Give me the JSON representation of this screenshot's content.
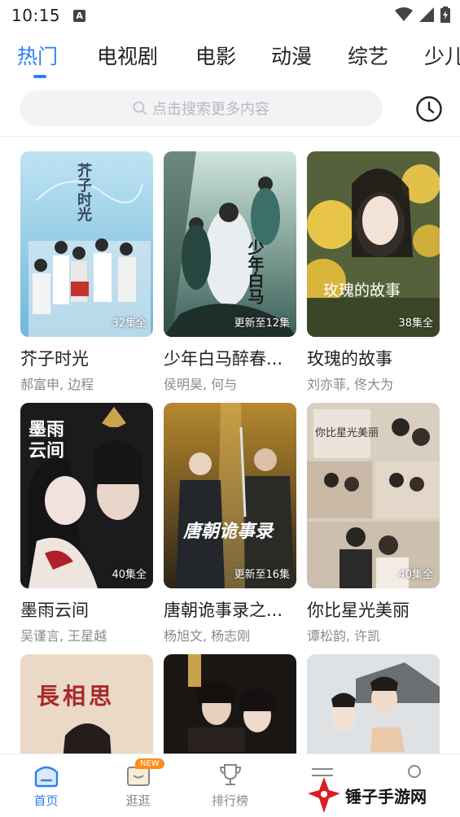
{
  "status_bar": {
    "time": "10:15",
    "notif_letter": "A"
  },
  "tabs": [
    {
      "label": "热门",
      "active": true
    },
    {
      "label": "电视剧",
      "active": false
    },
    {
      "label": "电影",
      "active": false
    },
    {
      "label": "动漫",
      "active": false
    },
    {
      "label": "综艺",
      "active": false
    },
    {
      "label": "少儿",
      "active": false
    }
  ],
  "search": {
    "placeholder": "点击搜索更多内容",
    "icon": "search-icon"
  },
  "history_icon": "clock-icon",
  "cards": [
    {
      "title": "芥子时光",
      "cast": "郝富申, 边程",
      "badge": "32集全",
      "poster_text": "芥子时光"
    },
    {
      "title": "少年白马醉春...",
      "cast": "侯明昊, 何与",
      "badge": "更新至12集",
      "poster_text": "少年白马"
    },
    {
      "title": "玫瑰的故事",
      "cast": "刘亦菲, 佟大为",
      "badge": "38集全",
      "poster_text": "玫瑰的故事"
    },
    {
      "title": "墨雨云间",
      "cast": "吴谨言, 王星越",
      "badge": "40集全",
      "poster_text": "墨雨云间"
    },
    {
      "title": "唐朝诡事录之...",
      "cast": "杨旭文, 杨志刚",
      "badge": "更新至16集",
      "poster_text": "唐朝诡事录"
    },
    {
      "title": "你比星光美丽",
      "cast": "谭松韵, 许凯",
      "badge": "40集全",
      "poster_text": "你比星光美丽"
    },
    {
      "title": "",
      "cast": "",
      "badge": "",
      "poster_text": "長相思"
    },
    {
      "title": "",
      "cast": "",
      "badge": "",
      "poster_text": ""
    },
    {
      "title": "",
      "cast": "",
      "badge": "",
      "poster_text": ""
    }
  ],
  "bottom_nav": [
    {
      "label": "首页",
      "icon": "home-icon",
      "active": true
    },
    {
      "label": "逛逛",
      "icon": "browse-box-icon",
      "active": false,
      "badge": "NEW"
    },
    {
      "label": "排行榜",
      "icon": "trophy-icon",
      "active": false
    },
    {
      "label": "",
      "icon": "menu-icon",
      "active": false
    },
    {
      "label": "",
      "icon": "profile-icon",
      "active": false
    }
  ],
  "watermark": {
    "text": "锤子手游网"
  },
  "colors": {
    "accent": "#2a7ff0",
    "badge_orange": "#ff8c1a",
    "search_bg": "#f2f3f5"
  }
}
